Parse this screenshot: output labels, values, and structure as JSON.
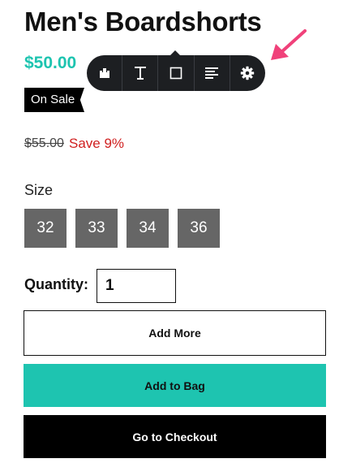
{
  "product": {
    "title": "Men's Boardshorts",
    "price": "$50.00",
    "badge": "On Sale",
    "old_price": "$55.00",
    "save_text": "Save 9%"
  },
  "toolbar": {
    "buttons": [
      "layout-icon",
      "text-icon",
      "box-icon",
      "align-icon",
      "gear-icon"
    ]
  },
  "size": {
    "label": "Size",
    "options": [
      "32",
      "33",
      "34",
      "36"
    ]
  },
  "quantity": {
    "label": "Quantity:",
    "value": "1"
  },
  "actions": {
    "add_more": "Add More",
    "add_to_bag": "Add to Bag",
    "checkout": "Go to Checkout"
  },
  "colors": {
    "accent": "#1ec4b0",
    "sale_red": "#d01f1f",
    "size_button": "#666666",
    "toolbar_bg": "#1d1f22",
    "annotation_arrow": "#f0417a"
  }
}
